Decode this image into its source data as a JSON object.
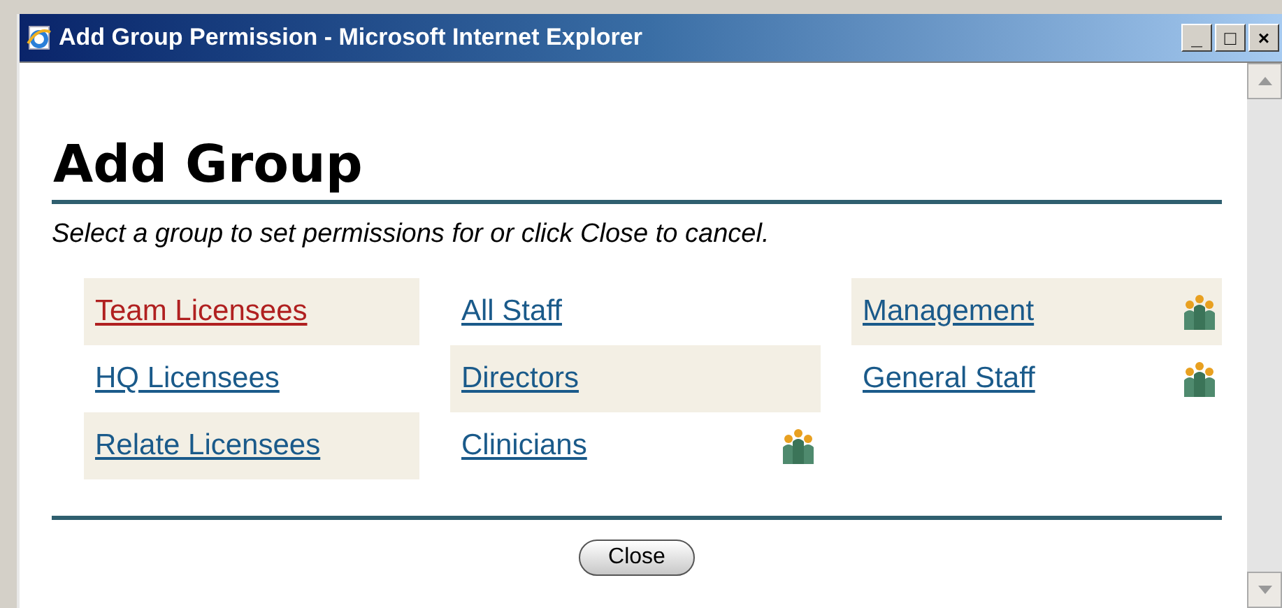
{
  "window": {
    "title": "Add Group Permission - Microsoft Internet Explorer",
    "controls": [
      "_",
      "□",
      "×"
    ]
  },
  "heading": "Add Group",
  "instructions": "Select a group to set permissions for or click Close to cancel.",
  "group_columns": [
    [
      {
        "label": "Team Licensees",
        "visited": true,
        "shaded": true,
        "group_icon": false
      },
      {
        "label": "HQ Licensees",
        "visited": false,
        "shaded": false,
        "group_icon": false
      },
      {
        "label": "Relate Licensees",
        "visited": false,
        "shaded": true,
        "group_icon": false
      }
    ],
    [
      {
        "label": "All Staff",
        "visited": false,
        "shaded": false,
        "group_icon": false
      },
      {
        "label": "Directors",
        "visited": false,
        "shaded": true,
        "group_icon": false
      },
      {
        "label": "Clinicians",
        "visited": false,
        "shaded": false,
        "group_icon": true
      }
    ],
    [
      {
        "label": "Management",
        "visited": false,
        "shaded": true,
        "group_icon": true
      },
      {
        "label": "General Staff",
        "visited": false,
        "shaded": false,
        "group_icon": true
      }
    ]
  ],
  "close_button": "Close"
}
